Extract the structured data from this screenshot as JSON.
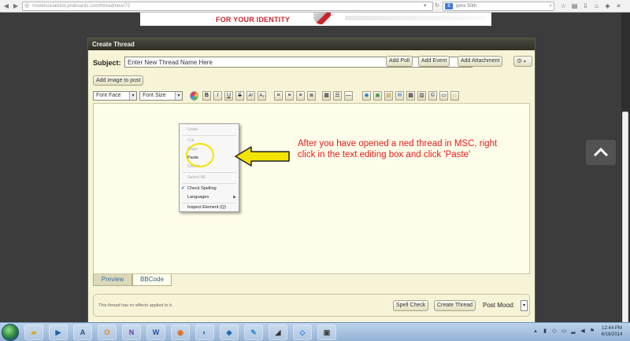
{
  "browser": {
    "url": "modelsocialclub.proboards.com/thread/new/72",
    "search_value": "ipms 50th",
    "search_engine_letter": "8"
  },
  "banner": {
    "tagline": "FOR YOUR IDENTITY"
  },
  "panel": {
    "title": "Create Thread",
    "subject_label": "Subject:",
    "subject_value": "Enter New Thread Name Here",
    "buttons": {
      "add_poll": "Add Poll",
      "add_event": "Add Event",
      "add_attachment": "Add Attachment"
    },
    "add_image_label": "Add image to post"
  },
  "toolbar": {
    "font_face": "Font Face",
    "font_size": "Font Size",
    "bold": "B",
    "italic": "I",
    "underline": "U",
    "strike": "S",
    "superscript": "A²",
    "subscript": "A₂"
  },
  "context_menu": {
    "undo": "Undo",
    "cut": "Cut",
    "copy": "Copy",
    "paste": "Paste",
    "delete": "Delete",
    "select_all": "Select All",
    "check_spelling": "Check Spelling",
    "languages": "Languages",
    "inspect_element": "Inspect Element (Q)"
  },
  "annotation": {
    "text": "After you have opened a ned thread in MSC, right click in the text editing box and click 'Paste'",
    "color": "#e31d1d",
    "circle_color": "#f2e400",
    "arrow_color": "#f2e400"
  },
  "tabs": {
    "preview": "Preview",
    "bbcode": "BBCode"
  },
  "footer": {
    "note": "This thread has no effects applied to it.",
    "spell_check": "Spell Check",
    "create_thread": "Create Thread",
    "post_mood": "Post Mood:"
  },
  "taskbar": {
    "time": "12:44 PM",
    "date": "6/18/2014"
  }
}
